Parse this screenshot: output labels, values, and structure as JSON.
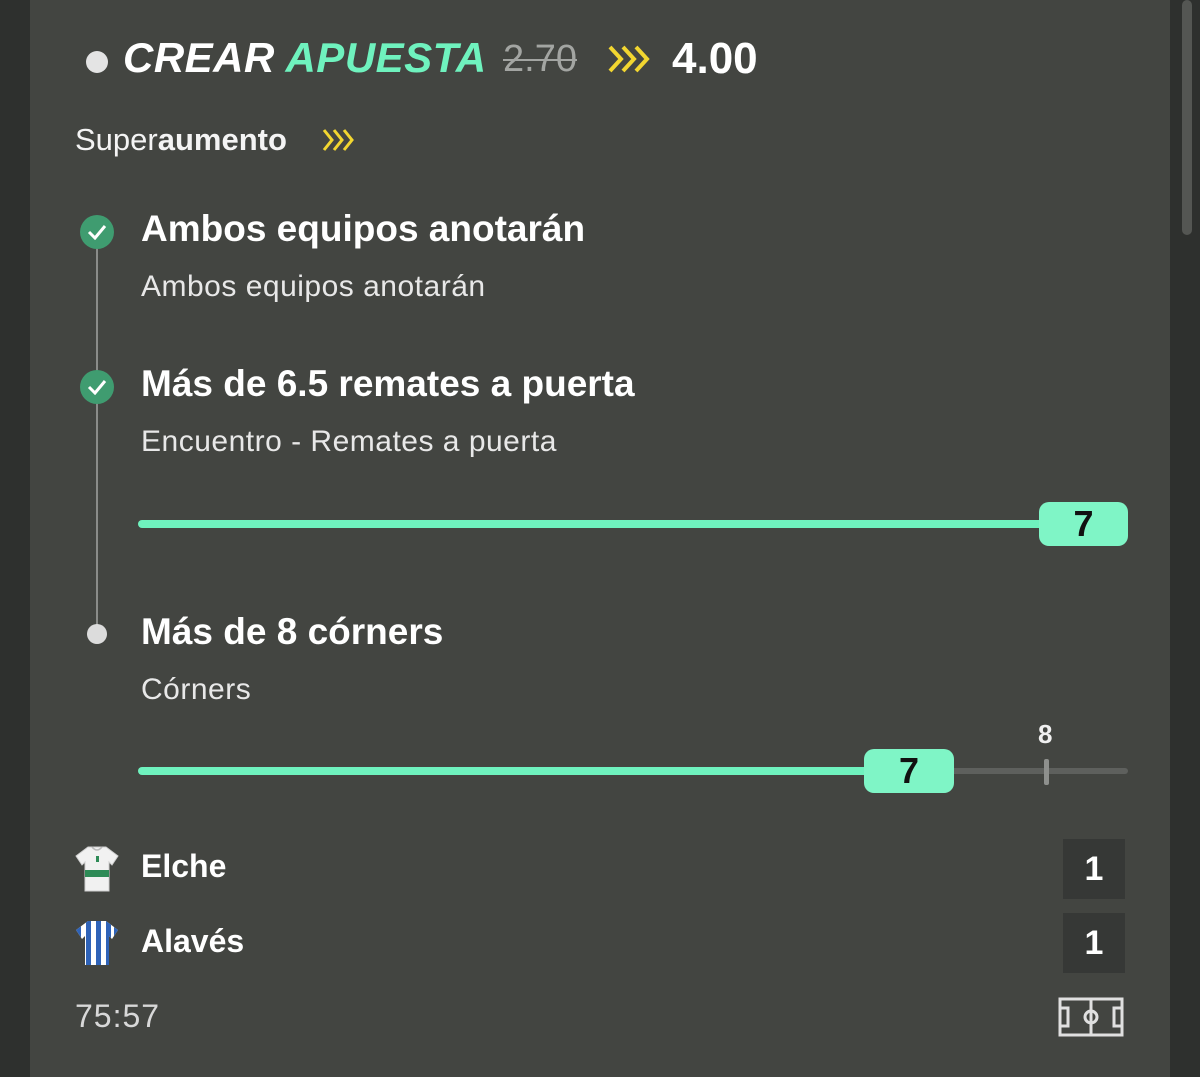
{
  "header": {
    "title_part1": "CREAR",
    "title_part2": "APUESTA",
    "old_odds": "2.70",
    "new_odds": "4.00"
  },
  "boost": {
    "prefix": "Super",
    "suffix": "aumento"
  },
  "legs": [
    {
      "title": "Ambos equipos anotarán",
      "subtitle": "Ambos equipos anotarán",
      "status": "won"
    },
    {
      "title": "Más de 6.5 remates a puerta",
      "subtitle": "Encuentro - Remates a puerta",
      "status": "won",
      "current_value": "7",
      "progress": 1.0
    },
    {
      "title": "Más de 8 córners",
      "subtitle": "Córners",
      "status": "pending",
      "current_value": "7",
      "target_value": "8",
      "progress": 0.875
    }
  ],
  "match": {
    "teams": [
      {
        "name": "Elche",
        "score": "1",
        "icon": "elche-shirt-icon"
      },
      {
        "name": "Alavés",
        "score": "1",
        "icon": "alaves-shirt-icon"
      }
    ],
    "clock": "75:57"
  },
  "colors": {
    "accent": "#6ff2be",
    "boost_chevron": "#f2d630",
    "check_green": "#3f9c70",
    "panel_bg": "#434541"
  }
}
